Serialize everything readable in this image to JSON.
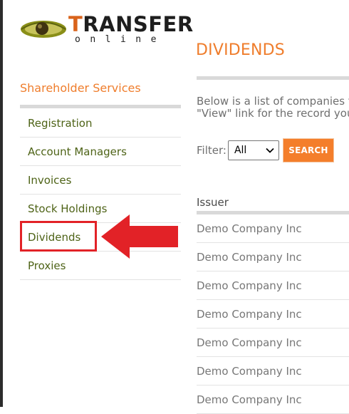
{
  "logo": {
    "main_first": "T",
    "main_rest": "RANSFER",
    "sub": "online"
  },
  "sidebar": {
    "title": "Shareholder Services",
    "items": [
      {
        "label": "Registration"
      },
      {
        "label": "Account Managers"
      },
      {
        "label": "Invoices"
      },
      {
        "label": "Stock Holdings"
      },
      {
        "label": "Dividends"
      },
      {
        "label": "Proxies"
      }
    ]
  },
  "main": {
    "title": "DIVIDENDS",
    "intro_line1": "Below is a list of companies th",
    "intro_line2": "\"View\" link for the record you",
    "filter": {
      "label": "Filter:",
      "selected": "All"
    },
    "search_label": "SEARCH",
    "table": {
      "header": "Issuer",
      "rows": [
        "Demo Company Inc",
        "Demo Company Inc",
        "Demo Company Inc",
        "Demo Company Inc",
        "Demo Company Inc",
        "Demo Company Inc",
        "Demo Company Inc"
      ]
    }
  },
  "colors": {
    "accent_orange": "#ef7d2c",
    "nav_green": "#4e6317",
    "annotation_red": "#e22227"
  }
}
